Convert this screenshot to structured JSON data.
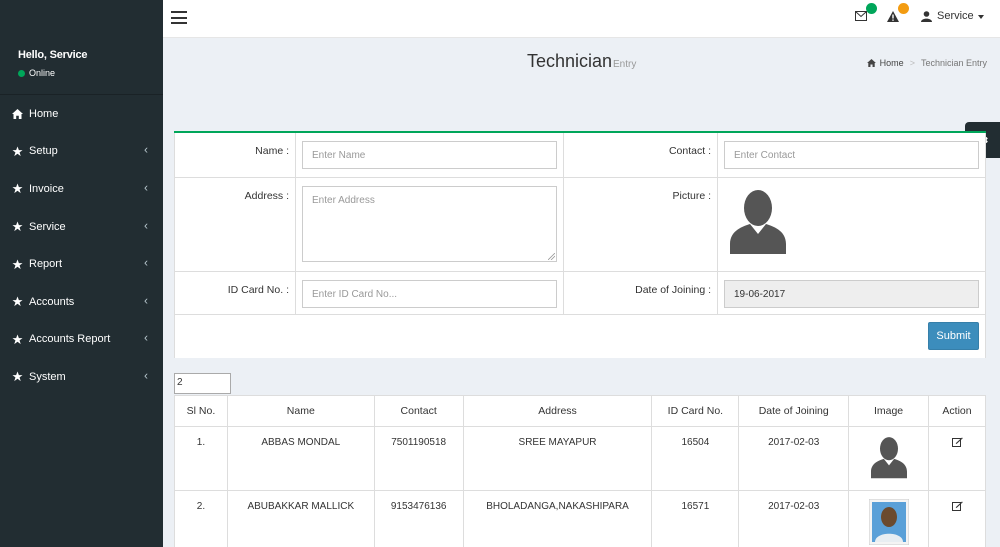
{
  "sidebar": {
    "user_greeting": "Hello, Service",
    "user_status": "Online",
    "items": [
      {
        "label": "Home",
        "has_children": false
      },
      {
        "label": "Setup",
        "has_children": true
      },
      {
        "label": "Invoice",
        "has_children": true
      },
      {
        "label": "Service",
        "has_children": true
      },
      {
        "label": "Report",
        "has_children": true
      },
      {
        "label": "Accounts",
        "has_children": true
      },
      {
        "label": "Accounts Report",
        "has_children": true
      },
      {
        "label": "System",
        "has_children": true
      }
    ]
  },
  "header": {
    "user_label": "Service",
    "badges": {
      "messages_color": "#00a65a",
      "alerts_color": "#f39c12"
    }
  },
  "page": {
    "title": "Technician",
    "subtitle": "Entry",
    "breadcrumb_home": "Home",
    "breadcrumb_current": "Technician Entry"
  },
  "form": {
    "name_label": "Name :",
    "name_placeholder": "Enter Name",
    "contact_label": "Contact :",
    "contact_placeholder": "Enter Contact",
    "address_label": "Address :",
    "address_placeholder": "Enter Address",
    "picture_label": "Picture :",
    "idcard_label": "ID Card No. :",
    "idcard_placeholder": "Enter ID Card No...",
    "doj_label": "Date of Joining :",
    "doj_value": "19-06-2017",
    "submit_label": "Submit"
  },
  "table": {
    "page_size": "2",
    "columns": [
      "Sl No.",
      "Name",
      "Contact",
      "Address",
      "ID Card No.",
      "Date of Joining",
      "Image",
      "Action"
    ],
    "rows": [
      {
        "sl": "1.",
        "name": "ABBAS MONDAL",
        "contact": "7501190518",
        "address": "SREE MAYAPUR",
        "idcard": "16504",
        "doj": "2017-02-03",
        "image": "avatar-placeholder"
      },
      {
        "sl": "2.",
        "name": "ABUBAKKAR MALLICK",
        "contact": "9153476136",
        "address": "BHOLADANGA,NAKASHIPARA",
        "idcard": "16571",
        "doj": "2017-02-03",
        "image": "photo"
      }
    ]
  },
  "colors": {
    "sidebar_bg": "#222d32",
    "accent_green": "#00a65a",
    "primary_button": "#3c8dbc"
  }
}
